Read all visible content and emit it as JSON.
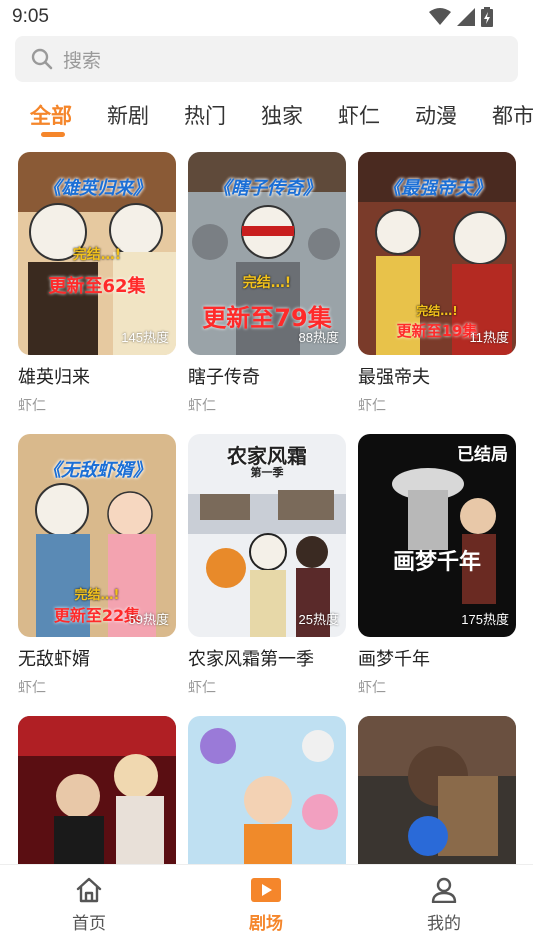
{
  "status_bar": {
    "time": "9:05"
  },
  "search": {
    "placeholder": "搜索"
  },
  "tabs": [
    {
      "label": "全部",
      "active": true
    },
    {
      "label": "新剧",
      "active": false
    },
    {
      "label": "热门",
      "active": false
    },
    {
      "label": "独家",
      "active": false
    },
    {
      "label": "虾仁",
      "active": false
    },
    {
      "label": "动漫",
      "active": false
    },
    {
      "label": "都市",
      "active": false
    }
  ],
  "cards": [
    {
      "title": "雄英归来",
      "tag": "虾仁",
      "heat": "145热度",
      "poster_title": "《雄英归来》",
      "poster_sub": "完结…!",
      "poster_update": "更新至62集"
    },
    {
      "title": "瞎子传奇",
      "tag": "虾仁",
      "heat": "88热度",
      "poster_title": "《瞎子传奇》",
      "poster_sub": "完结…!",
      "poster_update": "更新至79集"
    },
    {
      "title": "最强帝夫",
      "tag": "虾仁",
      "heat": "11热度",
      "poster_title": "《最强帝夫》",
      "poster_sub": "完结…!",
      "poster_update": "更新至19集"
    },
    {
      "title": "无敌虾婿",
      "tag": "虾仁",
      "heat": "59热度",
      "poster_title": "《无敌虾婿》",
      "poster_sub": "完结…!",
      "poster_update": "更新至22集"
    },
    {
      "title": "农家风霜第一季",
      "tag": "虾仁",
      "heat": "25热度",
      "poster_title": "农家风霜",
      "poster_sub": "第一季",
      "poster_update": ""
    },
    {
      "title": "画梦千年",
      "tag": "虾仁",
      "heat": "175热度",
      "poster_title": "已结局",
      "poster_sub": "画梦千年",
      "poster_update": ""
    },
    {
      "title": "",
      "tag": "",
      "heat": "",
      "poster_title": "",
      "poster_sub": "",
      "poster_update": ""
    },
    {
      "title": "",
      "tag": "",
      "heat": "",
      "poster_title": "",
      "poster_sub": "",
      "poster_update": ""
    },
    {
      "title": "",
      "tag": "",
      "heat": "",
      "poster_title": "",
      "poster_sub": "",
      "poster_update": ""
    }
  ],
  "bottom_nav": [
    {
      "label": "首页",
      "icon": "home-icon",
      "active": false
    },
    {
      "label": "剧场",
      "icon": "play-icon",
      "active": true
    },
    {
      "label": "我的",
      "icon": "user-icon",
      "active": false
    }
  ],
  "colors": {
    "accent": "#f5862b",
    "heat_text": "#ffffff",
    "tag_text": "#999999"
  }
}
